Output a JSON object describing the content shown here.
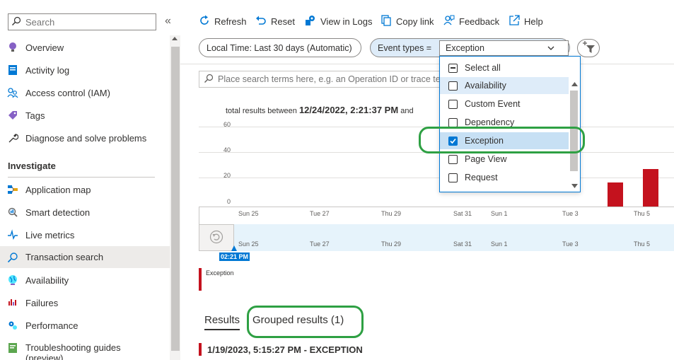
{
  "sidebar": {
    "search_placeholder": "Search",
    "collapse_glyph": "«",
    "items": [
      {
        "label": "Overview",
        "icon": "bulb-icon"
      },
      {
        "label": "Activity log",
        "icon": "activity-log-icon"
      },
      {
        "label": "Access control (IAM)",
        "icon": "people-icon"
      },
      {
        "label": "Tags",
        "icon": "tag-icon"
      },
      {
        "label": "Diagnose and solve problems",
        "icon": "wrench-icon"
      }
    ],
    "section_title": "Investigate",
    "investigate_items": [
      {
        "label": "Application map",
        "icon": "app-map-icon"
      },
      {
        "label": "Smart detection",
        "icon": "smart-detection-icon"
      },
      {
        "label": "Live metrics",
        "icon": "pulse-icon"
      },
      {
        "label": "Transaction search",
        "icon": "search-icon",
        "selected": true
      },
      {
        "label": "Availability",
        "icon": "globe-icon"
      },
      {
        "label": "Failures",
        "icon": "bar-chart-icon"
      },
      {
        "label": "Performance",
        "icon": "gears-icon"
      },
      {
        "label": "Troubleshooting guides (preview)",
        "icon": "guide-icon"
      }
    ]
  },
  "toolbar": {
    "refresh": "Refresh",
    "reset": "Reset",
    "view_in_logs": "View in Logs",
    "copy_link": "Copy link",
    "feedback": "Feedback",
    "help": "Help"
  },
  "filters": {
    "time_range": "Local Time: Last 30 days (Automatic)",
    "event_types_label": "Event types =",
    "event_types_value": "Exception"
  },
  "query_search": {
    "placeholder": "Place search terms here, e.g. an Operation ID or trace te"
  },
  "summary": {
    "prefix": "total results between",
    "start": "12/24/2022, 2:21:37 PM",
    "connector": "and"
  },
  "chart_data": {
    "type": "bar",
    "y_ticks": [
      "60",
      "40",
      "20",
      "0"
    ],
    "ylim": [
      0,
      60
    ],
    "x_ticks": [
      "Sun 25",
      "Tue 27",
      "Thu 29",
      "Sat 31",
      "Sun 1",
      "Tue 3",
      "Thu 5"
    ],
    "series": [
      {
        "name": "Exception",
        "color": "#c4121e",
        "points": [
          {
            "x": "Jan 4",
            "y": 18
          },
          {
            "x": "Thu 5",
            "y": 28
          }
        ]
      }
    ]
  },
  "timeline": {
    "x_ticks": [
      "Sun 25",
      "Tue 27",
      "Thu 29",
      "Sat 31",
      "Sun 1",
      "Tue 3",
      "Thu 5"
    ],
    "handle_time": "02:21 PM"
  },
  "legend": {
    "label": "Exception",
    "color": "#c4121e"
  },
  "tabs": {
    "results": "Results",
    "grouped": "Grouped results (1)"
  },
  "result": {
    "timestamp": "1/19/2023, 5:15:27 PM",
    "separator": "-",
    "type": "EXCEPTION"
  },
  "dropdown": {
    "items": [
      {
        "label": "Select all",
        "state": "partial"
      },
      {
        "label": "Availability",
        "state": "unchecked",
        "hover": true
      },
      {
        "label": "Custom Event",
        "state": "unchecked"
      },
      {
        "label": "Dependency",
        "state": "unchecked"
      },
      {
        "label": "Exception",
        "state": "checked"
      },
      {
        "label": "Page View",
        "state": "unchecked"
      },
      {
        "label": "Request",
        "state": "unchecked"
      }
    ]
  },
  "colors": {
    "accent": "#0078d4",
    "exception": "#c4121e",
    "annotation": "#2ea043"
  }
}
